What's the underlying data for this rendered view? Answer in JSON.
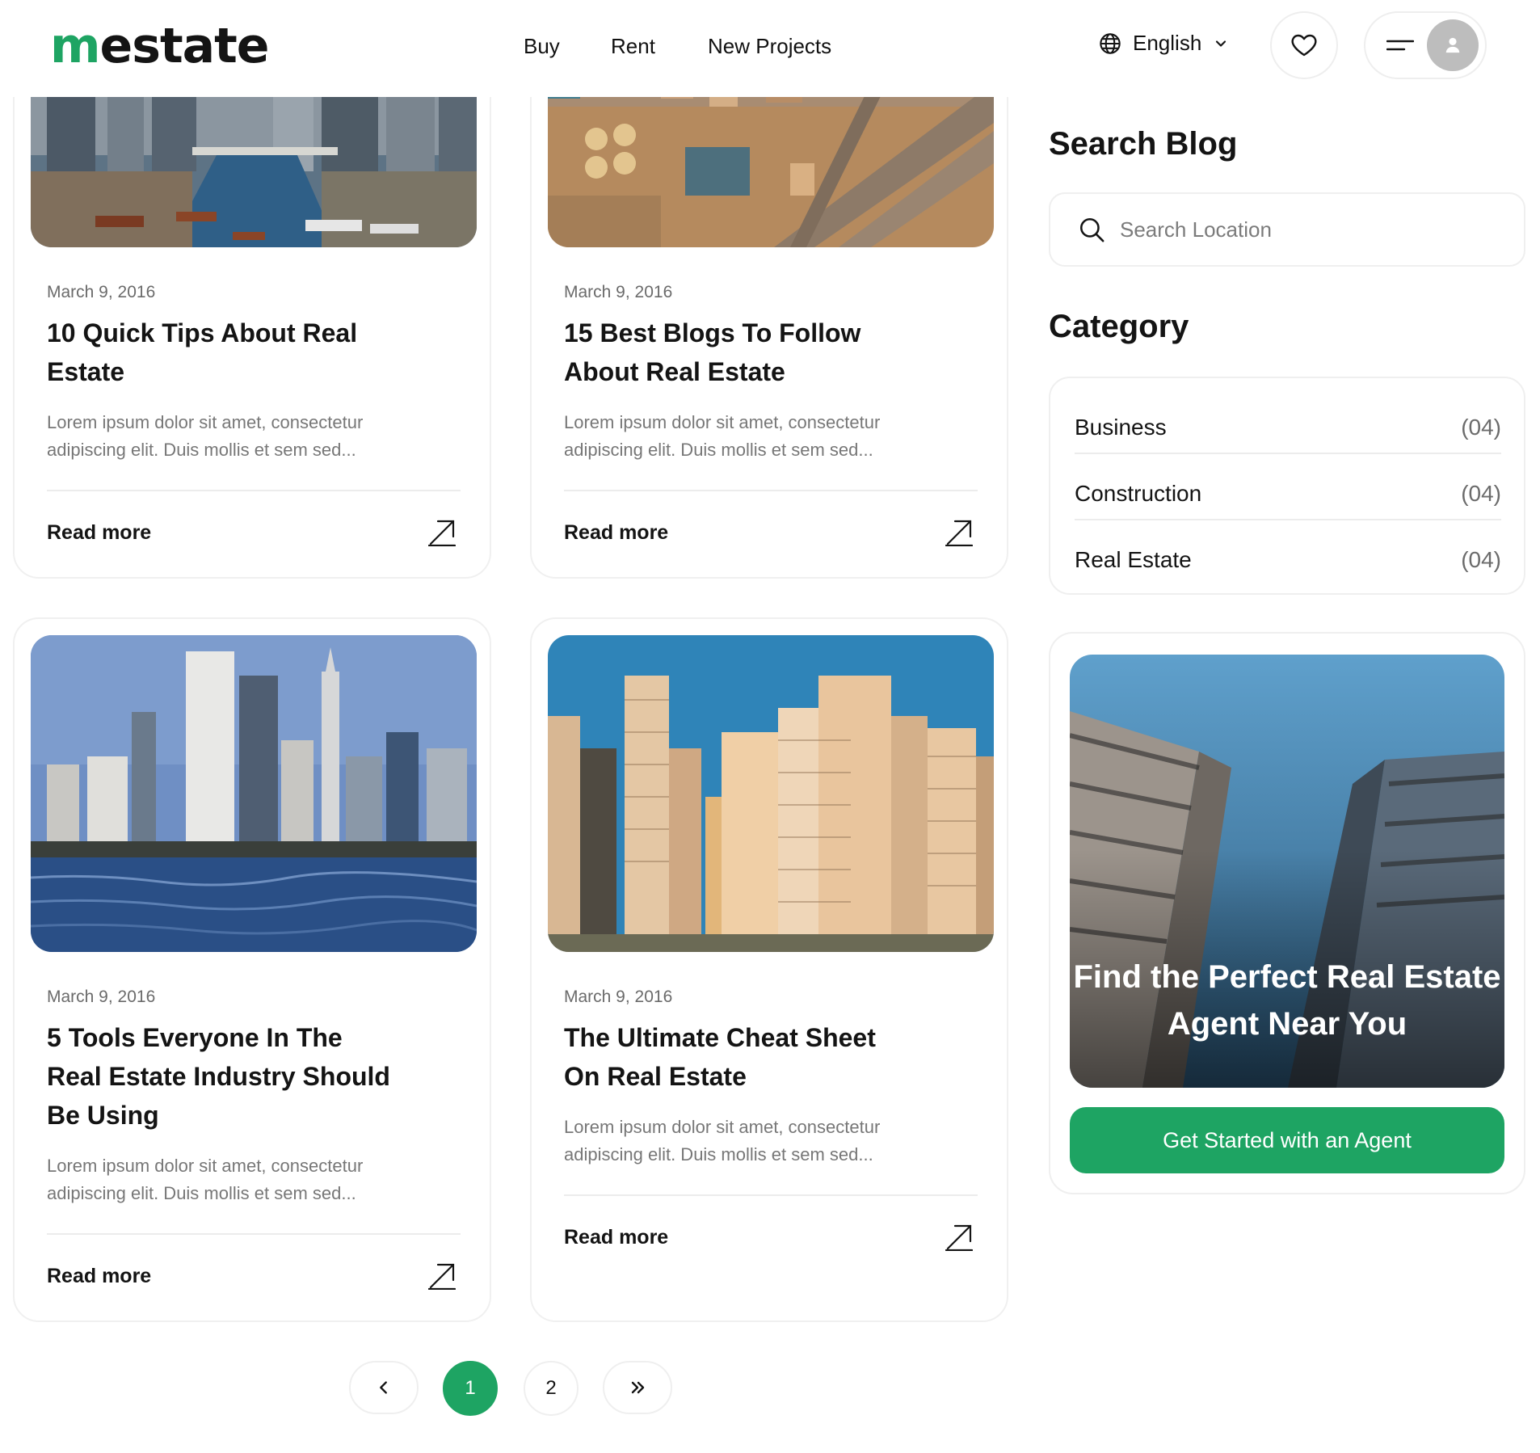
{
  "header": {
    "logo_m": "m",
    "logo_rest": "estate",
    "nav": [
      "Buy",
      "Rent",
      "New Projects"
    ],
    "language": "English",
    "icons": [
      "globe-icon",
      "chevron-down-icon",
      "heart-icon",
      "menu-icon",
      "user-icon"
    ]
  },
  "posts": [
    {
      "date": "March 9, 2016",
      "title": "10 Quick Tips About Real Estate",
      "excerpt": "Lorem ipsum dolor sit amet, consectetur adipiscing elit. Duis mollis et sem sed...",
      "read_more": "Read more"
    },
    {
      "date": "March 9, 2016",
      "title": "15 Best Blogs To Follow About Real Estate",
      "excerpt": "Lorem ipsum dolor sit amet, consectetur adipiscing elit. Duis mollis et sem sed...",
      "read_more": "Read more"
    },
    {
      "date": "March 9, 2016",
      "title": "5 Tools Everyone In The Real Estate Industry Should Be Using",
      "excerpt": "Lorem ipsum dolor sit amet, consectetur adipiscing elit. Duis mollis et sem sed...",
      "read_more": "Read more"
    },
    {
      "date": "March 9, 2016",
      "title": "The Ultimate Cheat Sheet On Real Estate",
      "excerpt": "Lorem ipsum dolor sit amet, consectetur adipiscing elit. Duis mollis et sem sed...",
      "read_more": "Read more"
    }
  ],
  "sidebar": {
    "search_heading": "Search Blog",
    "search_placeholder": "Search Location",
    "category_heading": "Category",
    "categories": [
      {
        "label": "Business",
        "count": "(04)"
      },
      {
        "label": "Construction",
        "count": "(04)"
      },
      {
        "label": "Real Estate",
        "count": "(04)"
      }
    ],
    "promo_title": "Find the Perfect Real Estate Agent Near You",
    "promo_button": "Get Started with an Agent"
  },
  "pagination": {
    "pages": [
      "1",
      "2"
    ],
    "current": "1",
    "icons": [
      "chevron-left-icon",
      "double-chevron-right-icon"
    ]
  },
  "colors": {
    "brand": "#1ea463",
    "text": "#141414",
    "muted": "#777777"
  }
}
